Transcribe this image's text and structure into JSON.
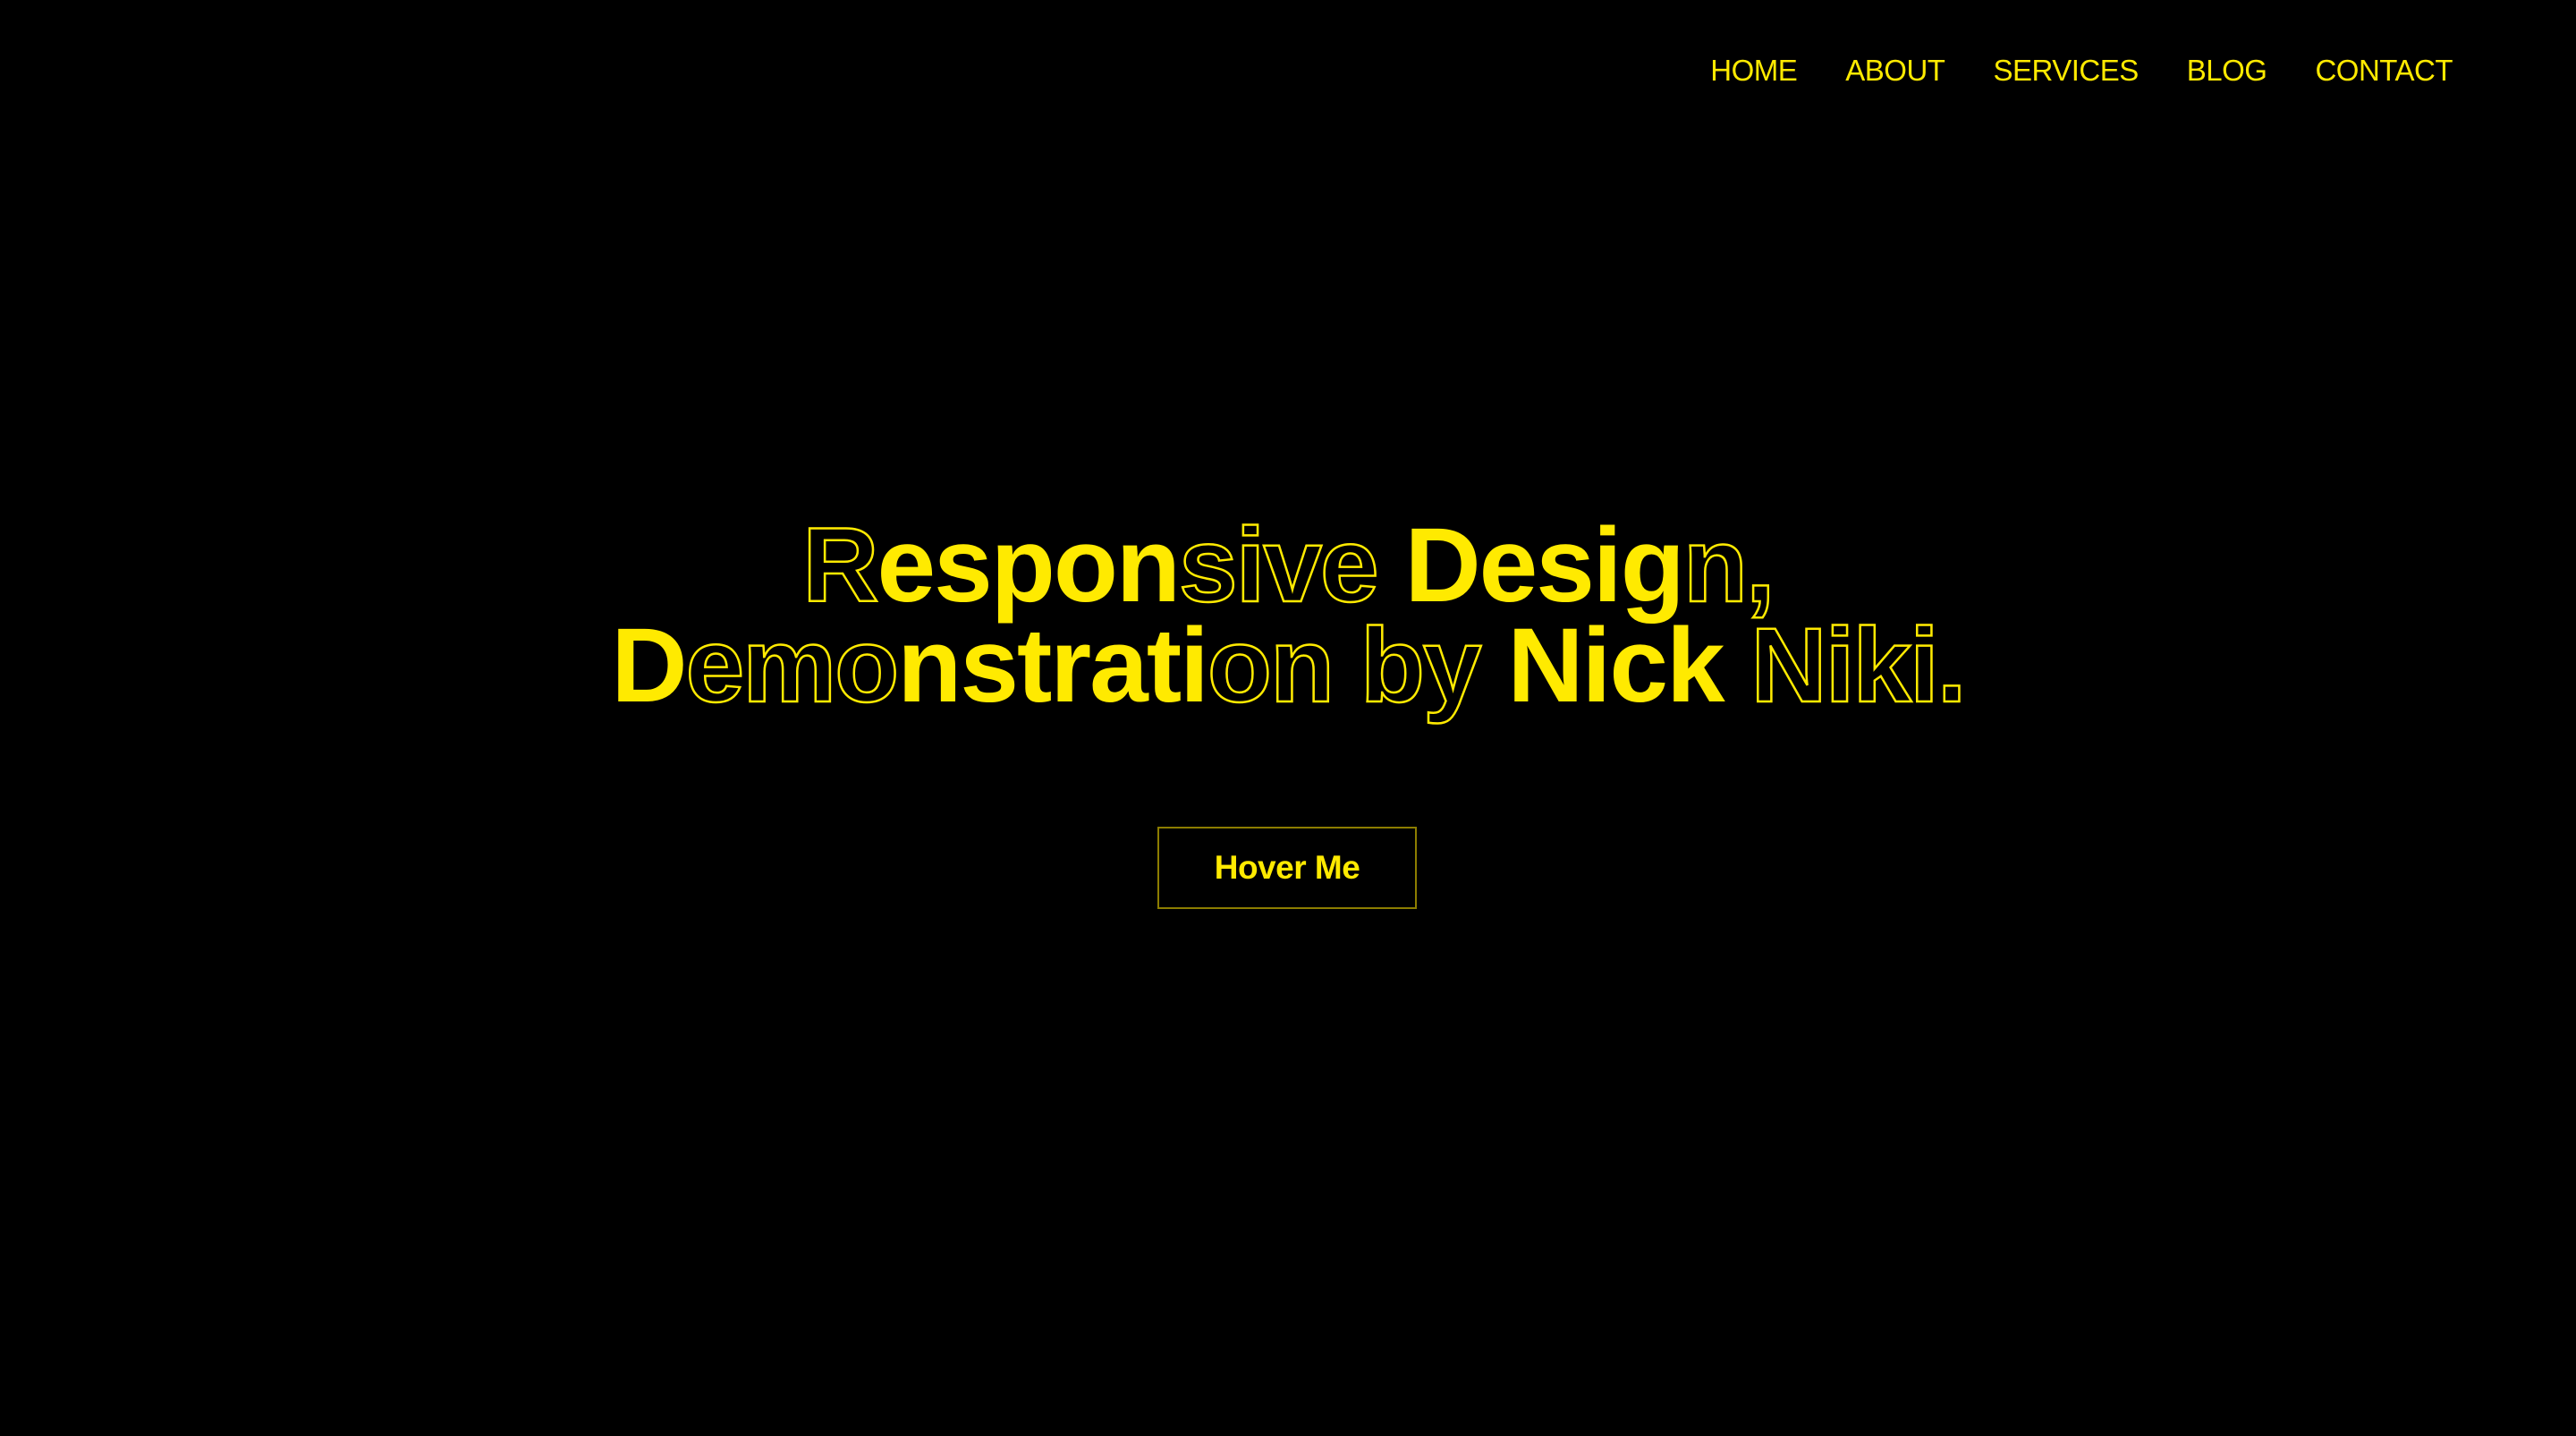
{
  "nav": {
    "items": [
      {
        "label": "HOME"
      },
      {
        "label": "ABOUT"
      },
      {
        "label": "SERVICES"
      },
      {
        "label": "BLOG"
      },
      {
        "label": "CONTACT"
      }
    ]
  },
  "hero": {
    "line1": [
      {
        "text": "R",
        "style": "outline"
      },
      {
        "text": "espon",
        "style": "filled"
      },
      {
        "text": "sive ",
        "style": "outline"
      },
      {
        "text": "Desig",
        "style": "filled"
      },
      {
        "text": "n,",
        "style": "outline"
      }
    ],
    "line2": [
      {
        "text": "D",
        "style": "filled"
      },
      {
        "text": "emo",
        "style": "outline"
      },
      {
        "text": "nstrati",
        "style": "filled"
      },
      {
        "text": "on by ",
        "style": "outline"
      },
      {
        "text": "Nick ",
        "style": "filled"
      },
      {
        "text": "Niki.",
        "style": "outline"
      }
    ],
    "button_label": "Hover Me"
  },
  "colors": {
    "background": "#000000",
    "accent": "#ffea00",
    "button_border": "#8c7d00"
  }
}
